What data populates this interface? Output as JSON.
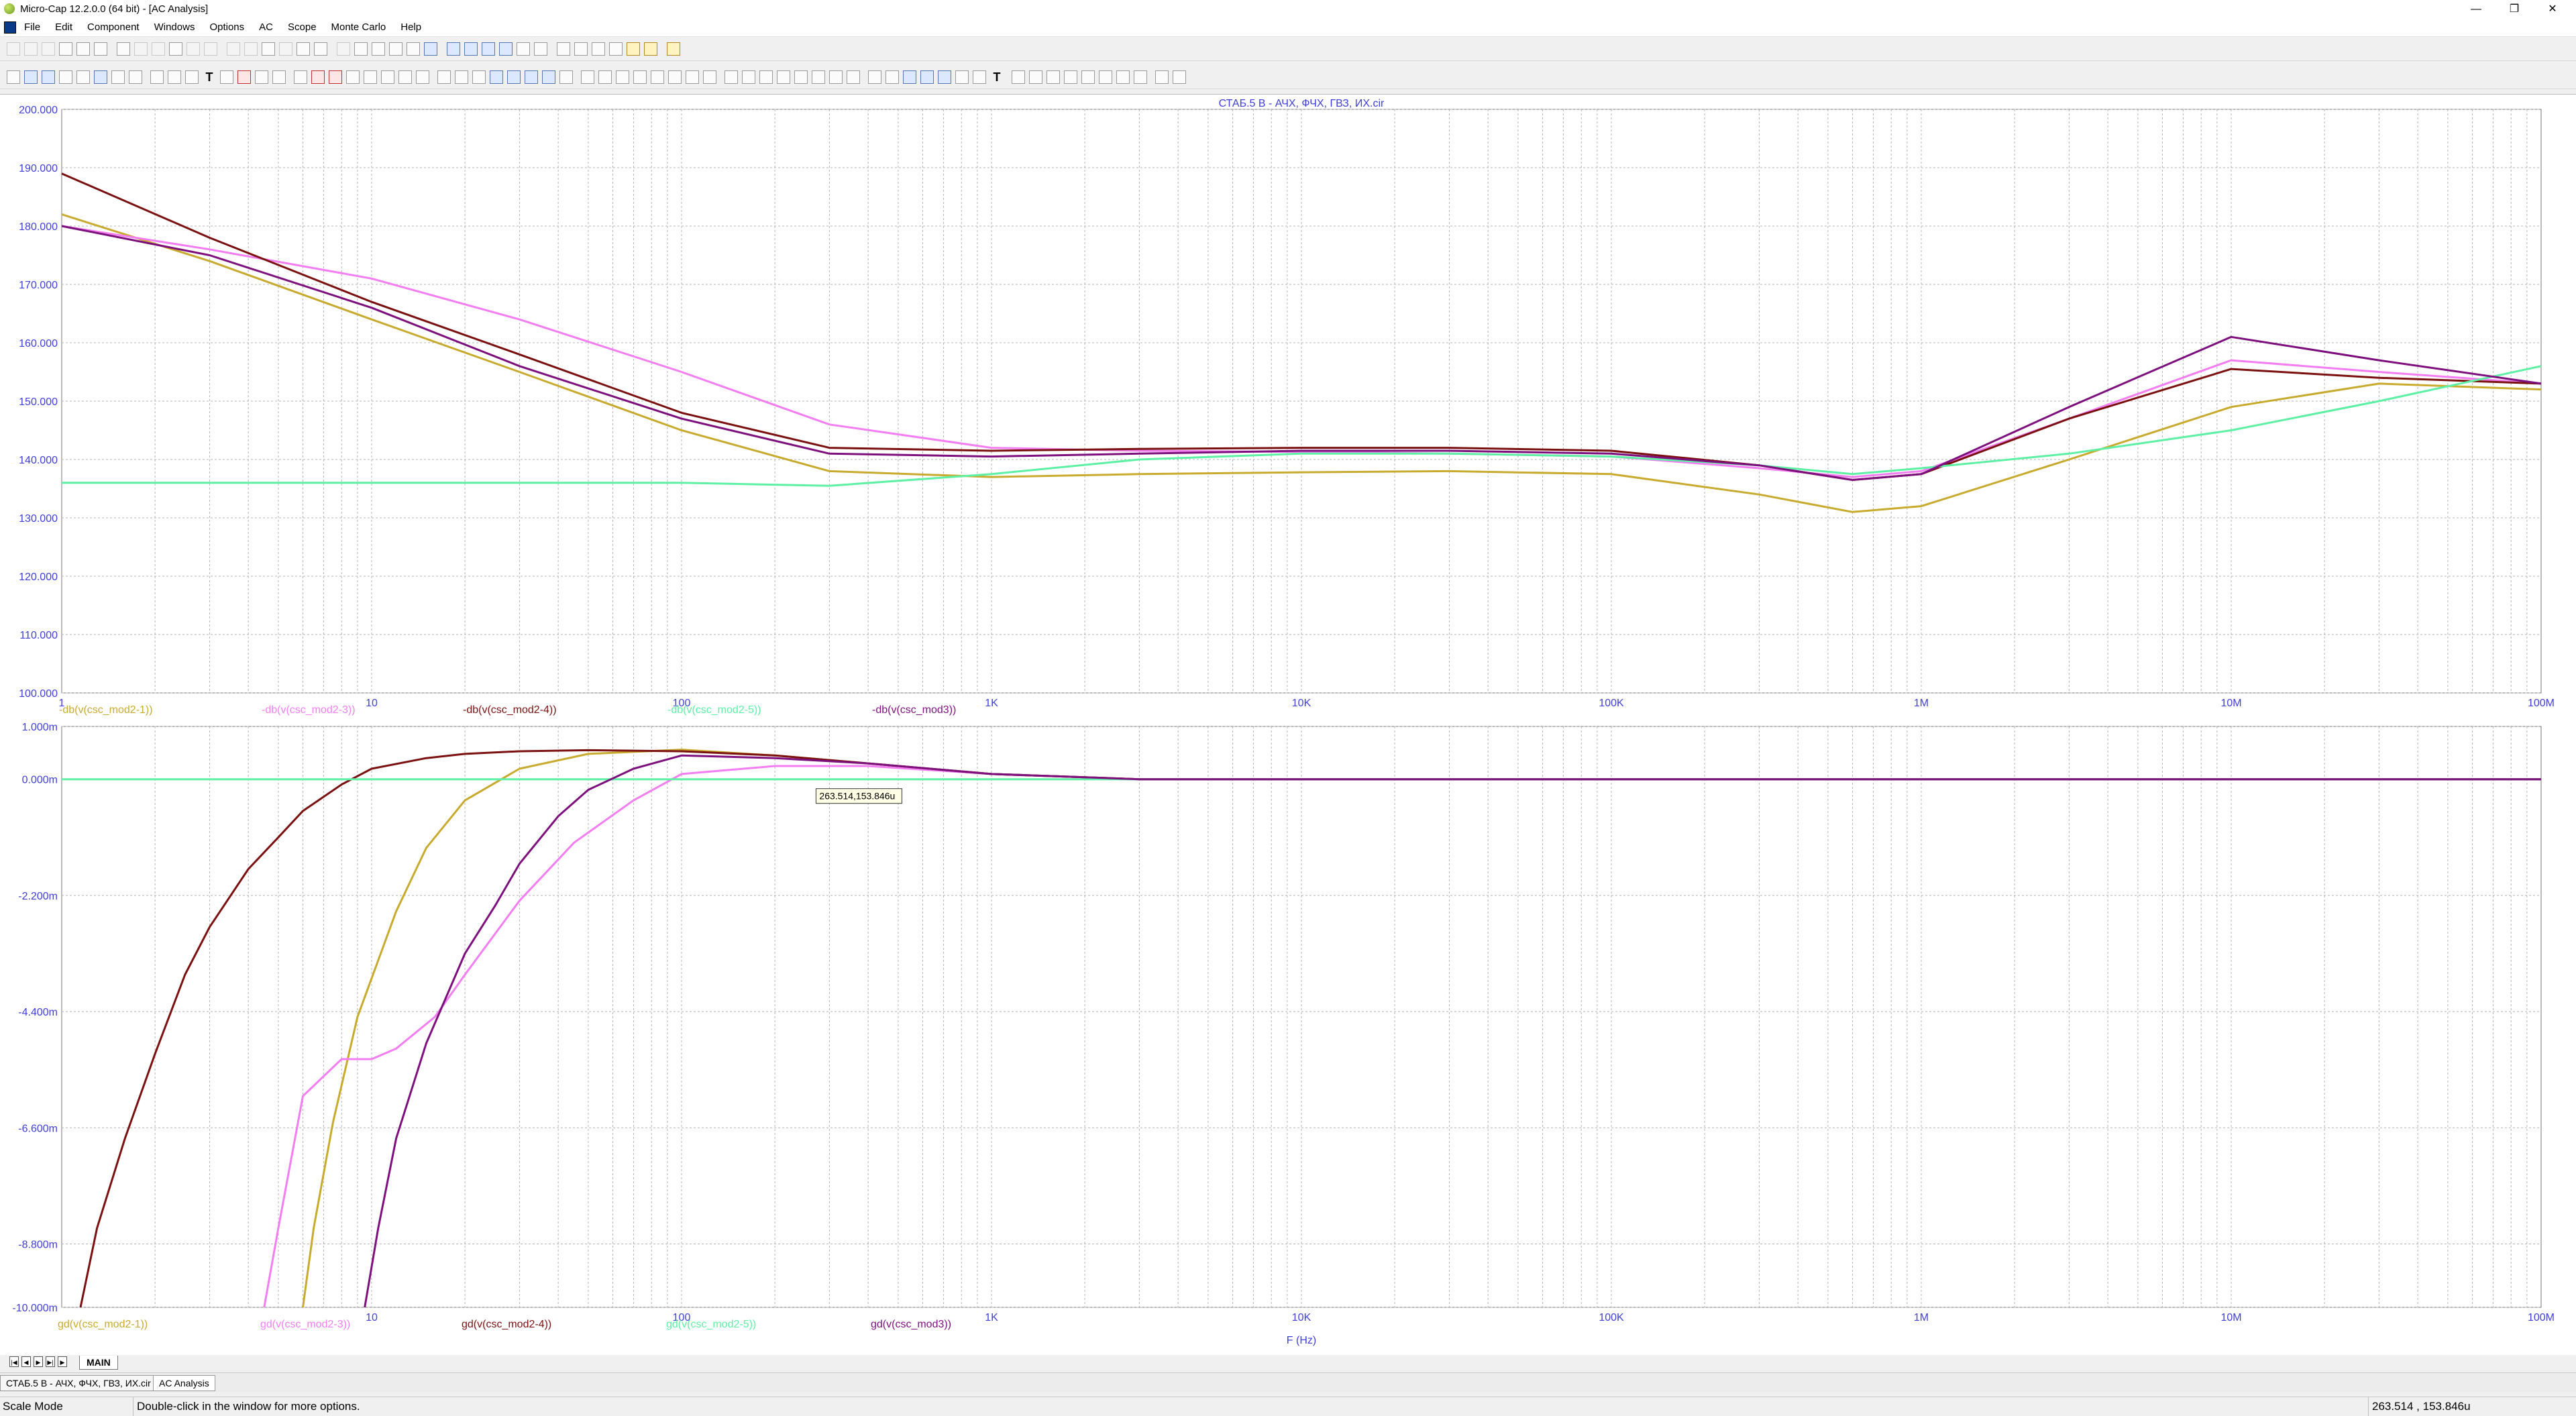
{
  "window": {
    "title": "Micro-Cap 12.2.0.0 (64 bit) - [AC Analysis]",
    "minimize": "—",
    "restore": "❐",
    "close": "✕"
  },
  "menu": [
    "File",
    "Edit",
    "Component",
    "Windows",
    "Options",
    "AC",
    "Scope",
    "Monte Carlo",
    "Help"
  ],
  "colors": {
    "mod2_1": "#c8ab2e",
    "mod2_3": "#f27ef2",
    "mod2_4": "#7a1010",
    "mod2_5": "#5ef0a4",
    "mod3": "#7d107d",
    "plot_title": "#3f3fd8",
    "tick_label": "#3f3fd8",
    "grid": "#b4b4b4"
  },
  "chart_data": [
    {
      "type": "line",
      "title": "СТАБ.5 В - АЧХ, ФЧХ, ГВЗ, ИХ.cir",
      "x_scale": "log",
      "xlim": [
        1,
        100000000
      ],
      "x_tick_labels": [
        "1",
        "10",
        "100",
        "1K",
        "10K",
        "100K",
        "1M",
        "10M",
        "100M"
      ],
      "ylim": [
        100,
        200
      ],
      "y_tick_labels": [
        "200.000",
        "190.000",
        "180.000",
        "170.000",
        "160.000",
        "150.000",
        "140.000",
        "130.000",
        "120.000",
        "110.000",
        "100.000"
      ],
      "grid": true,
      "legend": [
        "-db(v(csc_mod2-1))",
        "-db(v(csc_mod2-3))",
        "-db(v(csc_mod2-4))",
        "-db(v(csc_mod2-5))",
        "-db(v(csc_mod3))"
      ],
      "series": [
        {
          "name": "-db(v(csc_mod2-1))",
          "x": [
            1,
            3,
            10,
            30,
            100,
            300,
            1000,
            3000,
            10000,
            30000,
            100000,
            300000,
            600000,
            1000000,
            3000000,
            10000000,
            30000000,
            100000000
          ],
          "y": [
            182,
            174,
            164,
            155,
            145,
            138,
            137,
            137.5,
            137.8,
            138,
            137.5,
            134,
            131,
            132,
            140,
            149,
            153,
            152
          ]
        },
        {
          "name": "-db(v(csc_mod2-3))",
          "x": [
            1,
            3,
            10,
            30,
            100,
            300,
            1000,
            3000,
            10000,
            30000,
            100000,
            300000,
            600000,
            1000000,
            3000000,
            10000000,
            30000000,
            100000000
          ],
          "y": [
            180,
            176,
            171,
            164,
            155,
            146,
            142,
            141.5,
            141.3,
            141,
            140.5,
            138.5,
            137,
            138,
            147,
            157,
            155,
            153
          ]
        },
        {
          "name": "-db(v(csc_mod2-4))",
          "x": [
            1,
            3,
            10,
            30,
            100,
            300,
            1000,
            3000,
            10000,
            30000,
            100000,
            300000,
            600000,
            1000000,
            3000000,
            10000000,
            30000000,
            100000000
          ],
          "y": [
            189,
            178,
            167,
            158,
            148,
            142,
            141.5,
            141.8,
            142,
            142,
            141.5,
            139,
            136.5,
            137.5,
            147,
            155.5,
            154,
            153
          ]
        },
        {
          "name": "-db(v(csc_mod2-5))",
          "x": [
            1,
            3,
            10,
            30,
            100,
            300,
            1000,
            3000,
            10000,
            30000,
            100000,
            300000,
            600000,
            1000000,
            3000000,
            10000000,
            30000000,
            100000000
          ],
          "y": [
            136,
            136,
            136,
            136,
            136,
            135.5,
            137.5,
            140,
            141,
            141,
            140.5,
            139,
            137.5,
            138.5,
            141,
            145,
            150,
            156
          ]
        },
        {
          "name": "-db(v(csc_mod3))",
          "x": [
            1,
            3,
            10,
            30,
            100,
            300,
            1000,
            3000,
            10000,
            30000,
            100000,
            300000,
            600000,
            1000000,
            3000000,
            10000000,
            30000000,
            100000000
          ],
          "y": [
            180,
            175,
            166,
            156,
            147,
            141,
            140.5,
            141,
            141.5,
            141.5,
            141,
            139,
            136.5,
            137.5,
            149,
            161,
            157,
            153
          ]
        }
      ]
    },
    {
      "type": "line",
      "x_scale": "log",
      "xlim": [
        1,
        100000000
      ],
      "x_tick_labels": [
        "10",
        "100",
        "1K",
        "10K",
        "100K",
        "1M",
        "10M",
        "100M"
      ],
      "xlabel": "F (Hz)",
      "ylim": [
        -0.01,
        0.001
      ],
      "y_tick_labels": [
        "1.000m",
        "0.000m",
        "-2.200m",
        "-4.400m",
        "-6.600m",
        "-8.800m",
        "-10.000m"
      ],
      "grid": true,
      "legend": [
        "gd(v(csc_mod2-1))",
        "gd(v(csc_mod2-3))",
        "gd(v(csc_mod2-4))",
        "gd(v(csc_mod2-5))",
        "gd(v(csc_mod3))"
      ],
      "cursor_label": "263.514,153.846u",
      "series": [
        {
          "name": "gd(v(csc_mod2-1))",
          "x": [
            6,
            6.5,
            7.5,
            9,
            12,
            15,
            20,
            30,
            50,
            100,
            200,
            400,
            1000,
            3000,
            100000000
          ],
          "y": [
            -0.01,
            -0.0085,
            -0.0065,
            -0.0045,
            -0.0025,
            -0.0013,
            -0.0004,
            0.0002,
            0.00048,
            0.00056,
            0.00045,
            0.0003,
            0.0001,
            0,
            0
          ]
        },
        {
          "name": "gd(v(csc_mod2-3))",
          "x": [
            4.5,
            5,
            6,
            8,
            10,
            12,
            16,
            20,
            30,
            45,
            70,
            100,
            200,
            400,
            1000,
            3000,
            100000000
          ],
          "y": [
            -0.01,
            -0.0085,
            -0.006,
            -0.0053,
            -0.0053,
            -0.0051,
            -0.0045,
            -0.0037,
            -0.0023,
            -0.0012,
            -0.0004,
            0.0001,
            0.00025,
            0.00025,
            0.0001,
            0,
            0
          ]
        },
        {
          "name": "gd(v(csc_mod2-4))",
          "x": [
            1.15,
            1.3,
            1.6,
            2,
            2.5,
            3,
            4,
            5,
            6,
            8,
            10,
            15,
            20,
            30,
            50,
            100,
            200,
            400,
            1000,
            3000,
            100000000
          ],
          "y": [
            -0.01,
            -0.0085,
            -0.0068,
            -0.0052,
            -0.0037,
            -0.0028,
            -0.0017,
            -0.0011,
            -0.0006,
            -0.0001,
            0.0002,
            0.0004,
            0.00048,
            0.00053,
            0.00055,
            0.00053,
            0.00045,
            0.0003,
            0.0001,
            0,
            0
          ]
        },
        {
          "name": "gd(v(csc_mod2-5))",
          "x": [
            1,
            100000000
          ],
          "y": [
            0,
            0
          ]
        },
        {
          "name": "gd(v(csc_mod3))",
          "x": [
            9.5,
            10.5,
            12,
            15,
            20,
            25,
            30,
            40,
            50,
            70,
            100,
            200,
            400,
            1000,
            3000,
            100000000
          ],
          "y": [
            -0.01,
            -0.0085,
            -0.0068,
            -0.005,
            -0.0033,
            -0.0024,
            -0.0016,
            -0.0007,
            -0.0002,
            0.0002,
            0.00045,
            0.0004,
            0.0003,
            0.0001,
            0,
            0
          ]
        }
      ]
    }
  ],
  "tabs": {
    "main": "MAIN"
  },
  "doc_tabs": [
    "СТАБ.5 В - АЧХ, ФЧХ, ГВЗ, ИХ.cir",
    "AC Analysis"
  ],
  "status": {
    "mode": "Scale Mode",
    "hint": "Double-click in the window for more options.",
    "coords": "263.514 , 153.846u"
  }
}
